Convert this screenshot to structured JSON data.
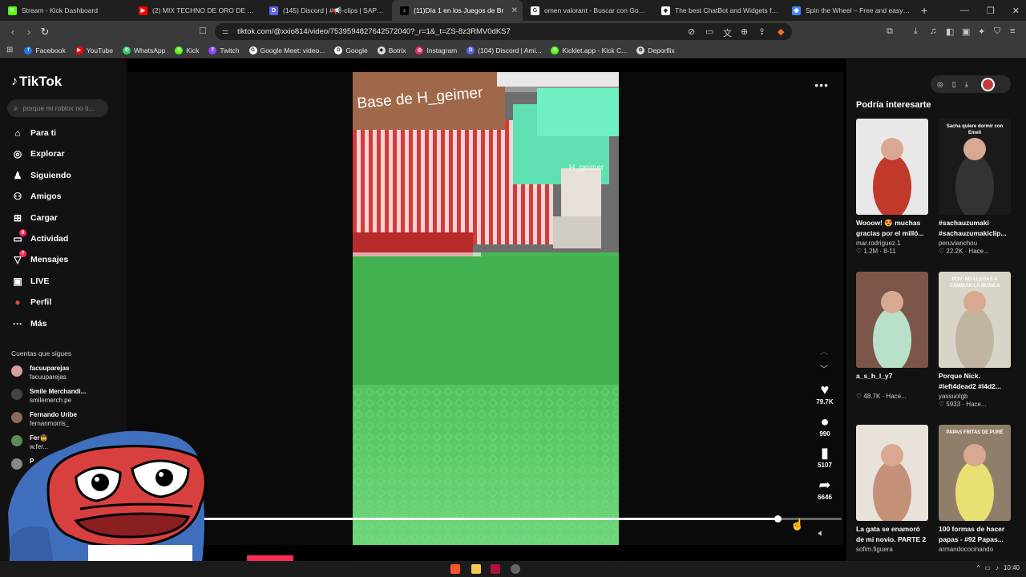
{
  "browser": {
    "tabs": [
      {
        "label": "Stream - Kick Dashboard",
        "fav_color": "#53fc18",
        "fav_glyph": "K",
        "active": false
      },
      {
        "label": "(2) MIX TECHNO DE ORO DE 80's &",
        "fav_color": "#ff0000",
        "fav_glyph": "▶",
        "active": false
      },
      {
        "label": "(145) Discord | #📢-clips | SAPOLIC",
        "fav_color": "#5865f2",
        "fav_glyph": "D",
        "active": false
      },
      {
        "label": "(11)Día 1 en los Juegos de Br",
        "fav_color": "#000000",
        "fav_glyph": "♪",
        "active": true
      },
      {
        "label": "omen valorant - Buscar con Google",
        "fav_color": "#ffffff",
        "fav_glyph": "G",
        "active": false
      },
      {
        "label": "The best ChatBot and Widgets for Ki",
        "fav_color": "#ffffff",
        "fav_glyph": "◆",
        "active": false
      },
      {
        "label": "Spin the Wheel – Free and easy-to-u",
        "fav_color": "#4285f4",
        "fav_glyph": "◉",
        "active": false
      }
    ],
    "new_tab": "+",
    "url": "tiktok.com/@xxio814/video/7539594827642572040?_r=1&_t=ZS-8z3RMV0dKS7",
    "bookmarks": [
      {
        "label": "Facebook",
        "color": "#1877f2",
        "glyph": "f"
      },
      {
        "label": "YouTube",
        "color": "#ff0000",
        "glyph": "▶"
      },
      {
        "label": "WhatsApp",
        "color": "#25d366",
        "glyph": "✆"
      },
      {
        "label": "Kick",
        "color": "#53fc18",
        "glyph": "K"
      },
      {
        "label": "Twitch",
        "color": "#9146ff",
        "glyph": "T"
      },
      {
        "label": "Google Meet: video...",
        "color": "#ffffff",
        "glyph": "G"
      },
      {
        "label": "Google",
        "color": "#ffffff",
        "glyph": "G"
      },
      {
        "label": "Botrix",
        "color": "#dddddd",
        "glyph": "◆"
      },
      {
        "label": "Instagram",
        "color": "#e1306c",
        "glyph": "◎"
      },
      {
        "label": "(104) Discord | Ami...",
        "color": "#5865f2",
        "glyph": "D"
      },
      {
        "label": "Kicklet.app - Kick C...",
        "color": "#53fc18",
        "glyph": "K"
      },
      {
        "label": "Deporflix",
        "color": "#dddddd",
        "glyph": "⚙"
      }
    ]
  },
  "tiktok": {
    "logo": "TikTok",
    "search_placeholder": "porque mi roblox no ti...",
    "nav": [
      {
        "label": "Para ti",
        "icon": "home-icon",
        "glyph": "⌂",
        "badge": ""
      },
      {
        "label": "Explorar",
        "icon": "compass-icon",
        "glyph": "◎",
        "badge": ""
      },
      {
        "label": "Siguiendo",
        "icon": "following-icon",
        "glyph": "♟",
        "badge": ""
      },
      {
        "label": "Amigos",
        "icon": "friends-icon",
        "glyph": "⚇",
        "badge": ""
      },
      {
        "label": "Cargar",
        "icon": "upload-icon",
        "glyph": "⊞",
        "badge": ""
      },
      {
        "label": "Actividad",
        "icon": "activity-icon",
        "glyph": "▭",
        "badge": "9"
      },
      {
        "label": "Mensajes",
        "icon": "messages-icon",
        "glyph": "▽",
        "badge": "7"
      },
      {
        "label": "LIVE",
        "icon": "live-icon",
        "glyph": "▣",
        "badge": ""
      },
      {
        "label": "Perfil",
        "icon": "profile-icon",
        "glyph": "●",
        "badge": ""
      },
      {
        "label": "Más",
        "icon": "more-icon",
        "glyph": "···",
        "badge": ""
      }
    ],
    "following_title": "Cuentas que sigues",
    "following": [
      {
        "name": "facuuparejas",
        "handle": "facuuparejas",
        "color": "#d9a0a0"
      },
      {
        "name": "Smile Merchandi...",
        "handle": "smilemerch.pe",
        "color": "#444444"
      },
      {
        "name": "Fernando Uribe",
        "handle": "fernanmorris_",
        "color": "#8c6a5a"
      },
      {
        "name": "Fer🤠",
        "handle": "w.fer...",
        "color": "#5a8a5a"
      },
      {
        "name": "P",
        "handle": "",
        "color": "#888888"
      }
    ],
    "video_text": {
      "sign": "Base de H_geimer",
      "player_tag": "H_geimer"
    },
    "actions": [
      {
        "icon": "heart-icon",
        "glyph": "♥",
        "count": "79.7K"
      },
      {
        "icon": "comment-icon",
        "glyph": "●",
        "count": "990"
      },
      {
        "icon": "bookmark-icon",
        "glyph": "▮",
        "count": "5107"
      },
      {
        "icon": "share-icon",
        "glyph": "➦",
        "count": "6646"
      }
    ],
    "progress_fraction": 0.9,
    "recommended_title": "Podría interesarte",
    "cards": [
      {
        "title": "Wooow! 😍 muchas gracias por el milló...",
        "user": "mar.rodriguez.1",
        "stats": "♡ 1.2M · 8-11",
        "bg": "#e8e8e8",
        "fg": "#c0392b",
        "overlay": ""
      },
      {
        "title": "#sachauzumaki #sachauzumakiclip...",
        "user": "peruvianchou",
        "stats": "♡ 22.2K · Hace...",
        "bg": "#1a1a1a",
        "fg": "#333333",
        "overlay": "Sacha quiere dormir con Emeli"
      },
      {
        "title": "a_s_h_l_y7",
        "user": "",
        "stats": "♡ 48.7K · Hace...",
        "bg": "#7a5548",
        "fg": "#b9e0c8",
        "overlay": ""
      },
      {
        "title": "Porque Nick. #left4dead2 #l4d2...",
        "user": "yassuotgb",
        "stats": "♡ 5933 · Hace...",
        "bg": "#d9d4c8",
        "fg": "#bfb5a0",
        "overlay": "POV: NO LLEGAS A CAMBIAR LA MUSICA"
      },
      {
        "title": "La gata se enamoró de mi novio. PARTE 2",
        "user": "sofim.figuera",
        "stats": "",
        "bg": "#e8e2da",
        "fg": "#c49078",
        "overlay": ""
      },
      {
        "title": "100 formas de hacer papas - #92 Papas...",
        "user": "armandococinando",
        "stats": "",
        "bg": "#8f7f6a",
        "fg": "#e8e070",
        "overlay": "PAPAS FRITAS DE PURÉ"
      }
    ]
  },
  "taskbar": {
    "time": "10:40"
  }
}
